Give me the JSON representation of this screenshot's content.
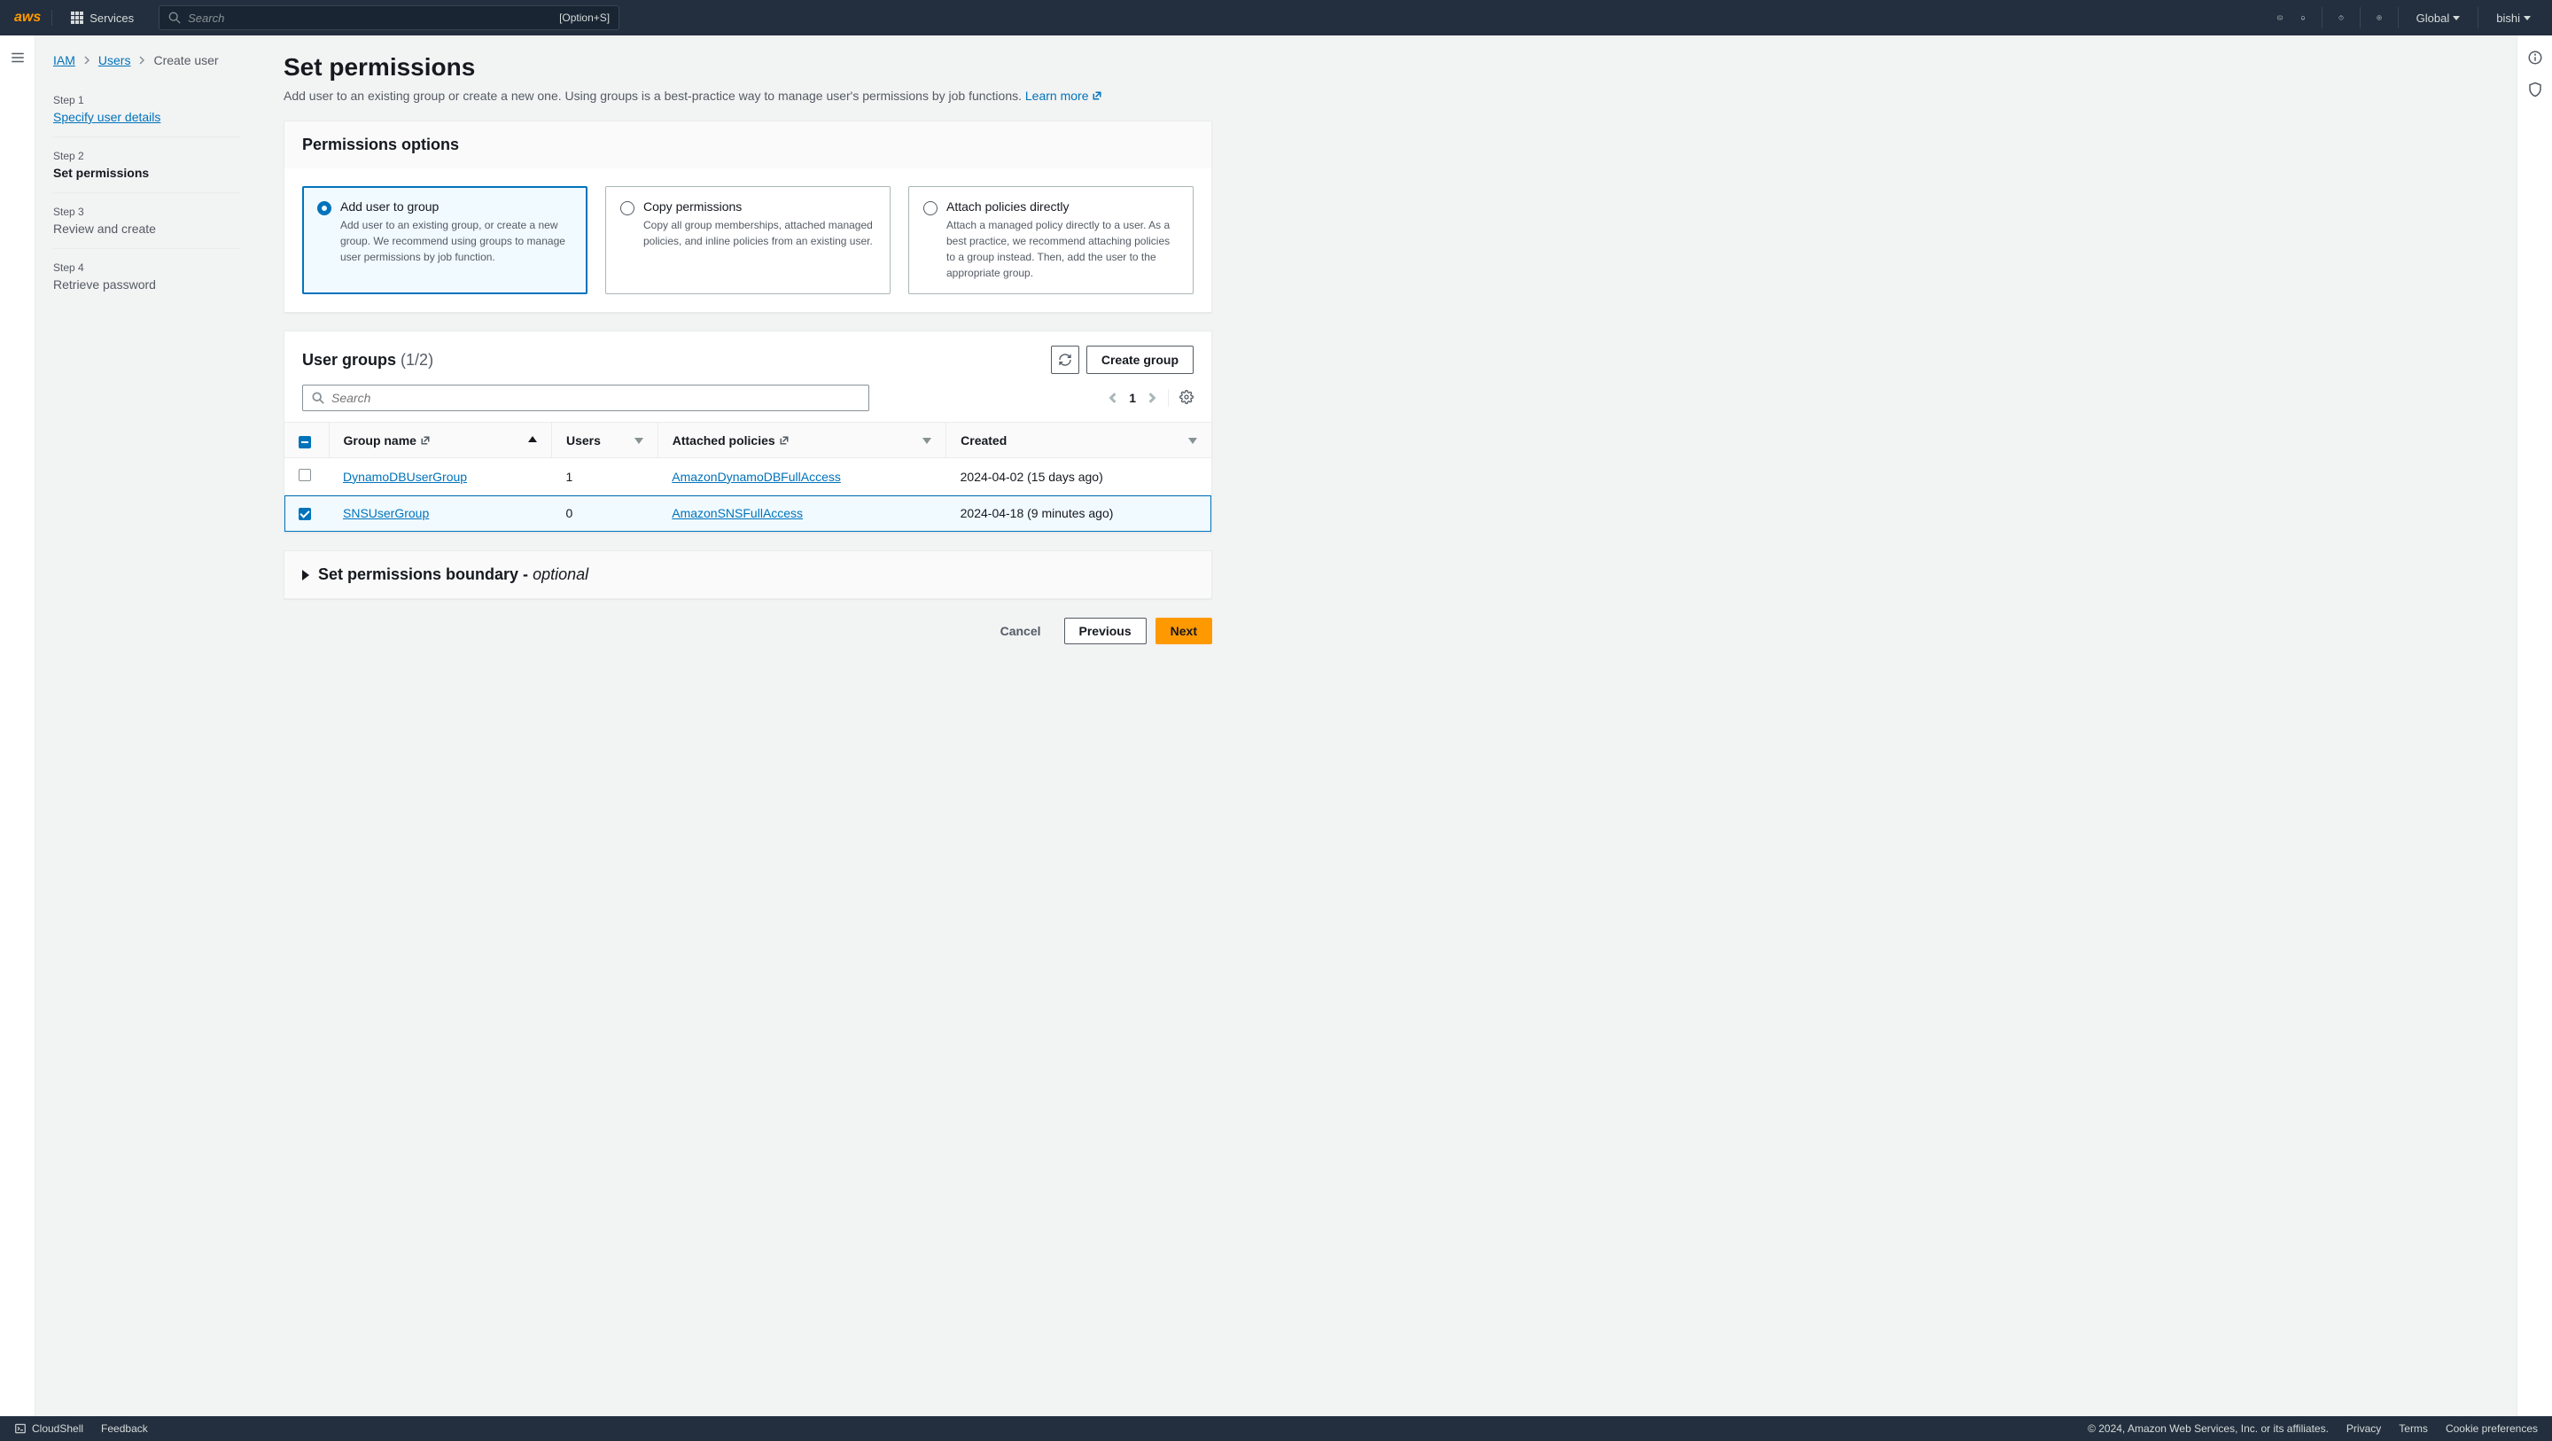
{
  "header": {
    "logo": "aws",
    "services_label": "Services",
    "search_placeholder": "Search",
    "search_shortcut": "[Option+S]",
    "region_label": "Global",
    "user_label": "bishi"
  },
  "breadcrumb": {
    "root": "IAM",
    "parent": "Users",
    "current": "Create user"
  },
  "steps": [
    {
      "label": "Step 1",
      "title": "Specify user details",
      "state": "link"
    },
    {
      "label": "Step 2",
      "title": "Set permissions",
      "state": "active"
    },
    {
      "label": "Step 3",
      "title": "Review and create",
      "state": "disabled"
    },
    {
      "label": "Step 4",
      "title": "Retrieve password",
      "state": "disabled"
    }
  ],
  "page": {
    "title": "Set permissions",
    "subtitle_text": "Add user to an existing group or create a new one. Using groups is a best-practice way to manage user's permissions by job functions. ",
    "learn_more": "Learn more"
  },
  "options_panel": {
    "heading": "Permissions options",
    "options": [
      {
        "title": "Add user to group",
        "desc": "Add user to an existing group, or create a new group. We recommend using groups to manage user permissions by job function.",
        "selected": true
      },
      {
        "title": "Copy permissions",
        "desc": "Copy all group memberships, attached managed policies, and inline policies from an existing user.",
        "selected": false
      },
      {
        "title": "Attach policies directly",
        "desc": "Attach a managed policy directly to a user. As a best practice, we recommend attaching policies to a group instead. Then, add the user to the appropriate group.",
        "selected": false
      }
    ]
  },
  "groups_panel": {
    "title": "User groups",
    "count": "(1/2)",
    "create_button": "Create group",
    "search_placeholder": "Search",
    "page_number": "1",
    "columns": {
      "group_name": "Group name",
      "users": "Users",
      "policies": "Attached policies",
      "created": "Created"
    },
    "rows": [
      {
        "selected": false,
        "name": "DynamoDBUserGroup",
        "users": "1",
        "policy": "AmazonDynamoDBFullAccess",
        "created": "2024-04-02 (15 days ago)"
      },
      {
        "selected": true,
        "name": "SNSUserGroup",
        "users": "0",
        "policy": "AmazonSNSFullAccess",
        "created": "2024-04-18 (9 minutes ago)"
      }
    ]
  },
  "boundary": {
    "title": "Set permissions boundary - ",
    "optional": "optional"
  },
  "wizard_buttons": {
    "cancel": "Cancel",
    "previous": "Previous",
    "next": "Next"
  },
  "footer": {
    "cloudshell": "CloudShell",
    "feedback": "Feedback",
    "copyright": "© 2024, Amazon Web Services, Inc. or its affiliates.",
    "privacy": "Privacy",
    "terms": "Terms",
    "cookies": "Cookie preferences"
  }
}
